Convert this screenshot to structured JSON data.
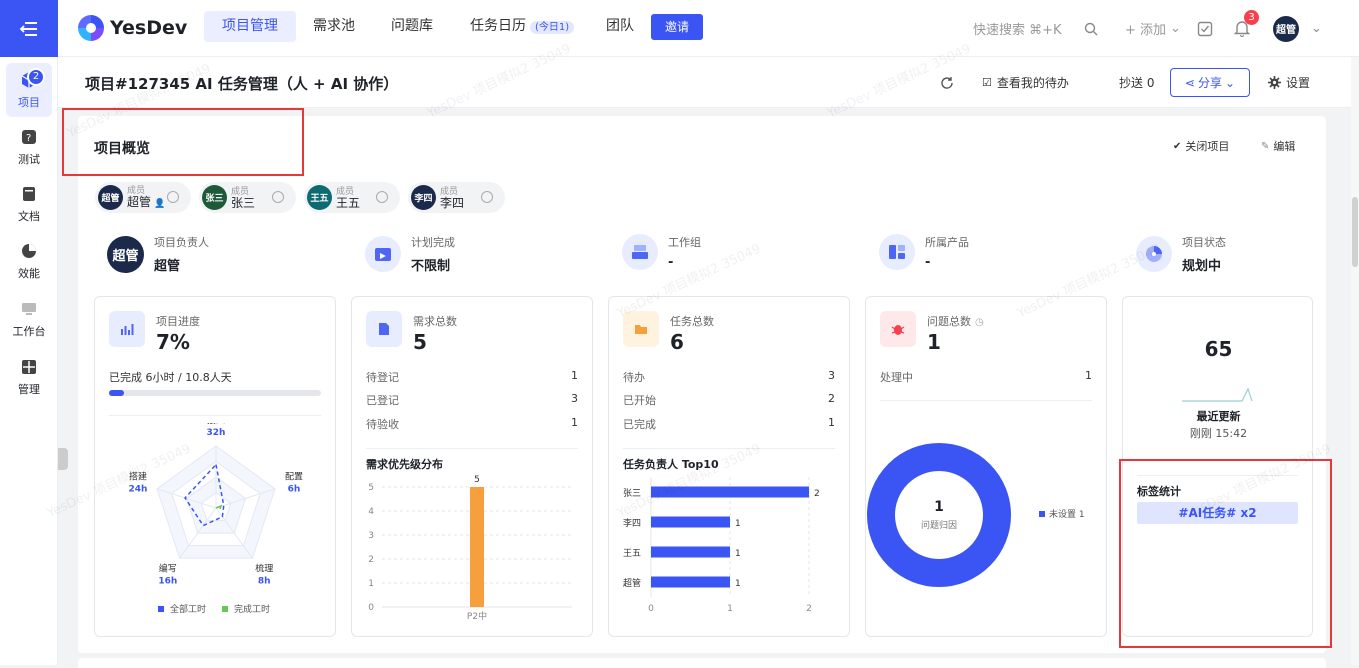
{
  "brand": "YesDev",
  "nav": {
    "tabs": [
      "项目管理",
      "需求池",
      "问题库",
      "任务日历",
      "团队"
    ],
    "today_tag": "(今日1)",
    "invite": "邀请",
    "search": "快速搜索 ⌘+K",
    "add": "+ 添加",
    "notify_count": "3",
    "user": "超管"
  },
  "sidebar": {
    "items": [
      {
        "label": "项目",
        "badge": "2"
      },
      {
        "label": "测试"
      },
      {
        "label": "文档"
      },
      {
        "label": "效能"
      },
      {
        "label": "工作台"
      },
      {
        "label": "管理"
      }
    ]
  },
  "header": {
    "title": "项目#127345 AI 任务管理（人 + AI 协作）",
    "my_todo": "查看我的待办",
    "cc": "抄送 0",
    "share": "分享",
    "settings": "设置"
  },
  "overview": {
    "title": "项目概览",
    "close": "关闭项目",
    "edit": "编辑",
    "members": [
      {
        "role": "成员",
        "name": "超管",
        "avatar": "超管",
        "color": "#1b2a4a"
      },
      {
        "role": "成员",
        "name": "张三",
        "avatar": "张三",
        "color": "#1e5a3a"
      },
      {
        "role": "成员",
        "name": "王五",
        "avatar": "王五",
        "color": "#0e6a72"
      },
      {
        "role": "成员",
        "name": "李四",
        "avatar": "李四",
        "color": "#1b2a4a"
      }
    ],
    "info": [
      {
        "label": "项目负责人",
        "value": "超管"
      },
      {
        "label": "计划完成",
        "value": "不限制"
      },
      {
        "label": "工作组",
        "value": "-"
      },
      {
        "label": "所属产品",
        "value": "-"
      },
      {
        "label": "项目状态",
        "value": "规划中"
      }
    ]
  },
  "cards": {
    "progress": {
      "title": "项目进度",
      "value": "7%",
      "detail": "已完成 6小时 / 10.8人天",
      "percent": 7,
      "radar": {
        "axes": [
          {
            "name": "接入",
            "value": "32h"
          },
          {
            "name": "配置",
            "value": "6h"
          },
          {
            "name": "梳理",
            "value": "8h"
          },
          {
            "name": "编写",
            "value": "16h"
          },
          {
            "name": "搭建",
            "value": "24h"
          }
        ],
        "legend": [
          "全部工时",
          "完成工时"
        ]
      }
    },
    "requirements": {
      "title": "需求总数",
      "value": "5",
      "rows": [
        {
          "k": "待登记",
          "v": "1"
        },
        {
          "k": "已登记",
          "v": "3"
        },
        {
          "k": "待验收",
          "v": "1"
        }
      ],
      "chart_title": "需求优先级分布"
    },
    "tasks": {
      "title": "任务总数",
      "value": "6",
      "rows": [
        {
          "k": "待办",
          "v": "3"
        },
        {
          "k": "已开始",
          "v": "2"
        },
        {
          "k": "已完成",
          "v": "1"
        }
      ],
      "chart_title": "任务负责人 Top10"
    },
    "issues": {
      "title": "问题总数",
      "value": "1",
      "rows": [
        {
          "k": "处理中",
          "v": "1"
        }
      ],
      "donut_value": "1",
      "donut_label": "问题归因",
      "legend": "未设置 1"
    },
    "activity": {
      "value": "65",
      "label": "最近更新",
      "time": "刚刚 15:42",
      "tag_title": "标签统计",
      "tag": "#AI任务# x2"
    }
  },
  "chart_data": [
    {
      "type": "bar",
      "categories": [
        "P2中"
      ],
      "values": [
        5
      ],
      "title": "需求优先级分布",
      "ylim": [
        0,
        5
      ],
      "yticks": [
        0,
        1,
        2,
        3,
        4,
        5
      ],
      "color": "#f5a03c"
    },
    {
      "type": "bar",
      "orientation": "horizontal",
      "categories": [
        "张三",
        "李四",
        "王五",
        "超管"
      ],
      "values": [
        2,
        1,
        1,
        1
      ],
      "title": "任务负责人 Top10",
      "xlim": [
        0,
        2
      ],
      "xticks": [
        0,
        1,
        2
      ],
      "color": "#3a55f4"
    }
  ],
  "watermark": "YesDev 项目模拟2 35049",
  "colors": {
    "accent": "#3a55f4",
    "highlight": "#e4383a",
    "bar_orange": "#f5a03c"
  }
}
